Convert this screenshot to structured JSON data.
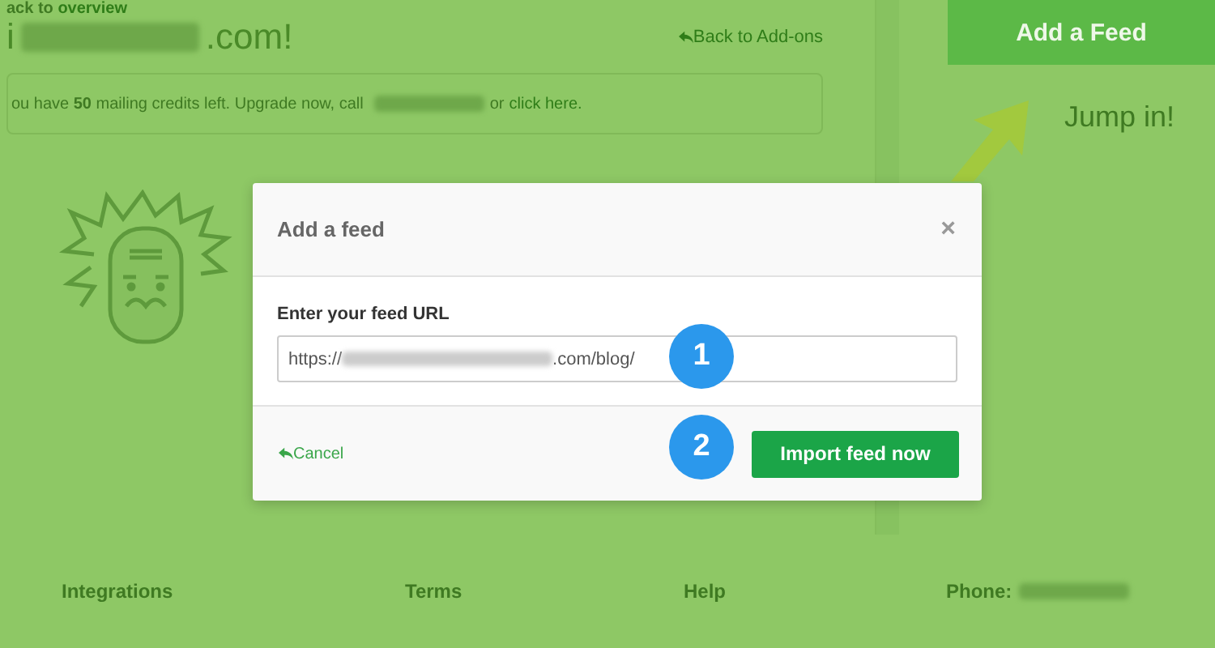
{
  "page": {
    "breadcrumb": {
      "prefix": "ack to ",
      "link": "overview"
    },
    "heading": {
      "start": "i",
      "end": ".com!"
    },
    "back_link": "Back to Add-ons",
    "notice": {
      "text": "ou have **50** mailing credits left. Upgrade now, call",
      "or": "or",
      "link": "click here."
    }
  },
  "sidebar": {
    "button": "Add a Feed",
    "caption": "Jump in!"
  },
  "footer": {
    "links": [
      "Integrations",
      "Terms",
      "Help"
    ],
    "phone_label": "Phone:"
  },
  "modal": {
    "title": "Add a feed",
    "close": "×",
    "field_label": "Enter your feed URL",
    "url_start": "https://",
    "url_end": ".com/blog/",
    "cancel": "Cancel",
    "submit": "Import feed now"
  },
  "callouts": [
    "1",
    "2"
  ]
}
